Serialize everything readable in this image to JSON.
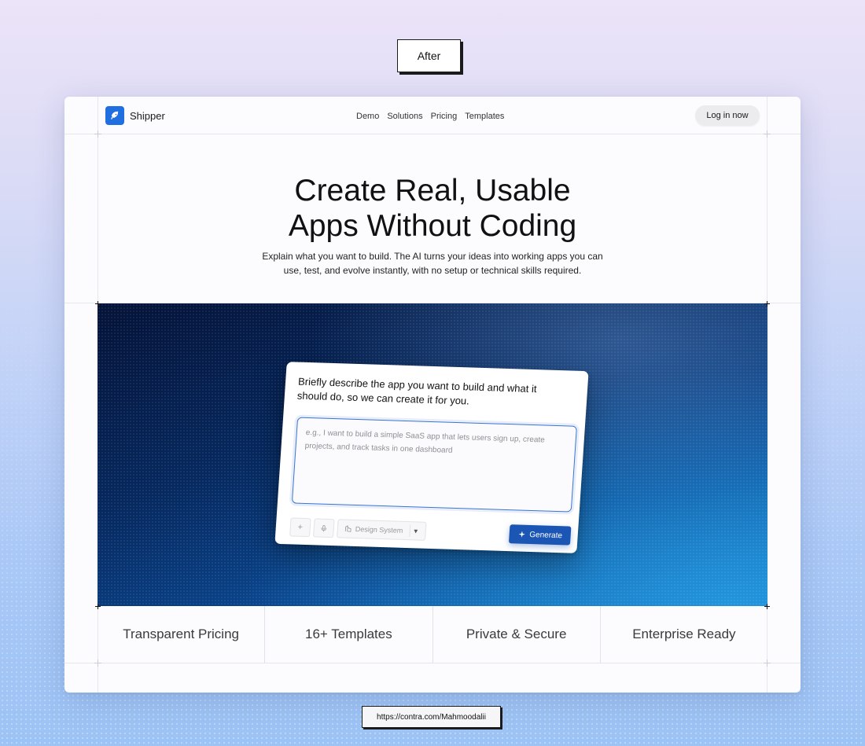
{
  "annotation": {
    "after_label": "After",
    "url_label": "https://contra.com/Mahmoodalii"
  },
  "nav": {
    "brand": "Shipper",
    "logo_icon": "rocket-icon",
    "links": [
      "Demo",
      "Solutions",
      "Pricing",
      "Templates"
    ],
    "login_label": "Log in now"
  },
  "hero": {
    "title_line1": "Create Real, Usable",
    "title_line2": "Apps Without Coding",
    "subtitle": "Explain what you want to build. The AI turns your ideas into working apps you can use, test, and evolve instantly, with no setup or technical skills required."
  },
  "prompt": {
    "question": "Briefly describe the app you want to build and what it should do, so we can create it for you.",
    "placeholder": "e.g., I want to build a simple SaaS app that lets users sign up, create projects, and track tasks in one dashboard",
    "value": "",
    "add_icon": "plus-icon",
    "mic_icon": "microphone-icon",
    "design_system_label": "Design System",
    "generate_label": "Generate",
    "accent_color": "#1b56b5"
  },
  "features": [
    "Transparent Pricing",
    "16+ Templates",
    "Private & Secure",
    "Enterprise Ready"
  ]
}
